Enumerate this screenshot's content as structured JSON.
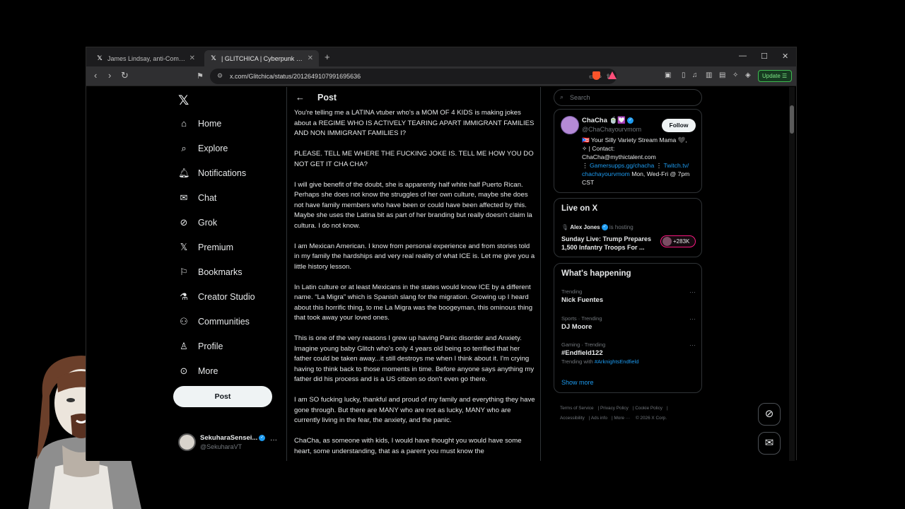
{
  "browser": {
    "tabs": [
      {
        "title": "James Lindsay, anti-Communist on X",
        "active": false
      },
      {
        "title": "| GLITCHICA | Cyberpunk Vtuber",
        "active": true
      }
    ],
    "url": "x.com/Glitchica/status/2012649107991695636",
    "update_label": "Update"
  },
  "nav": {
    "items": [
      {
        "id": "home",
        "label": "Home",
        "icon": "home-icon"
      },
      {
        "id": "explore",
        "label": "Explore",
        "icon": "search-icon"
      },
      {
        "id": "notifications",
        "label": "Notifications",
        "icon": "bell-icon"
      },
      {
        "id": "chat",
        "label": "Chat",
        "icon": "mail-icon"
      },
      {
        "id": "grok",
        "label": "Grok",
        "icon": "grok-icon"
      },
      {
        "id": "premium",
        "label": "Premium",
        "icon": "x-logo-icon"
      },
      {
        "id": "bookmarks",
        "label": "Bookmarks",
        "icon": "bookmark-icon"
      },
      {
        "id": "creator-studio",
        "label": "Creator Studio",
        "icon": "flask-icon"
      },
      {
        "id": "communities",
        "label": "Communities",
        "icon": "people-icon"
      },
      {
        "id": "profile",
        "label": "Profile",
        "icon": "person-icon"
      },
      {
        "id": "more",
        "label": "More",
        "icon": "more-circle-icon"
      }
    ],
    "post_button": "Post",
    "account": {
      "name": "SekuharaSensei...",
      "handle": "@SekuharaVT"
    }
  },
  "post": {
    "header_title": "Post",
    "paragraphs": [
      "You're telling me a LATINA vtuber who's a MOM OF 4 KIDS is making jokes about a REGIME WHO IS ACTIVELY TEARING APART IMMIGRANT FAMILIES AND NON IMMIGRANT FAMILIES I?",
      "PLEASE. TELL ME WHERE THE FUCKING JOKE IS. TELL ME HOW YOU DO NOT GET IT CHA CHA?",
      "I will give benefit of the doubt, she is apparently half white half Puerto Rican. Perhaps she does not know the struggles of her own culture, maybe she does not have family members who have been or could have been affected by this. Maybe she uses the Latina bit as part of her branding but really doesn't claim la cultura. I do not know.",
      "I am Mexican American. I know from personal experience and from stories told in my family the hardships and very real reality of what ICE is. Let me give you a little history lesson.",
      "In Latin culture or at least Mexicans in the states would know ICE by a different name. “La Migra” which is Spanish slang for the migration. Growing up I heard about this horrific thing, to me La Migra was the boogeyman, this ominous thing that took away your loved ones.",
      "This is one of the very reasons I grew up having Panic disorder and Anxiety. Imagine young baby Glitch who's only 4 years old being so terrified that her father could be taken away...it still destroys me when I think about it. I'm crying having to think back to those moments in time. Before anyone says anything my father did his process and is a US citizen so don't even go there.",
      "I am SO fucking lucky, thankful and proud of my family and everything they have gone through. But there are MANY who are not as lucky, MANY who are currently living in the fear, the anxiety, and the panic.",
      "ChaCha, as someone with kids, I would have thought you would have some heart, some understanding, that as a parent you must know the"
    ]
  },
  "sidebar": {
    "search_placeholder": "Search",
    "profile": {
      "name": "ChaCha 🍵💟",
      "handle": "@ChaChayourvmom",
      "follow_label": "Follow",
      "bio_line1": "🇵🇷 Your Silly Variety Stream Mama 🖤,",
      "bio_line2": "✧ | Contact:",
      "bio_line3": "ChaCha@mythictalent.com",
      "bio_link1": "Gamersupps.gg/chacha",
      "bio_link2": "Twitch.tv/",
      "bio_link3": "chachayourvmom",
      "bio_tail": "Mon, Wed-Fri @ 7pm CST"
    },
    "live": {
      "title": "Live on X",
      "host": "Alex Jones",
      "host_suffix": "is hosting",
      "stream_title": "Sunday Live: Trump Prepares 1,500 Infantry Troops For ...",
      "viewers": "+283K"
    },
    "happening": {
      "title": "What's happening",
      "trends": [
        {
          "context": "Trending",
          "name": "Nick Fuentes",
          "with": ""
        },
        {
          "context": "Sports · Trending",
          "name": "DJ Moore",
          "with": ""
        },
        {
          "context": "Gaming · Trending",
          "name": "#Endfield122",
          "with_prefix": "Trending with",
          "with": "#ArknightsEndfield"
        }
      ],
      "show_more": "Show more"
    },
    "footer": [
      "Terms of Service",
      "Privacy Policy",
      "Cookie Policy",
      "Accessibility",
      "Ads info",
      "More ···",
      "© 2026 X Corp."
    ]
  },
  "colors": {
    "accent": "#1d9bf0",
    "background": "#000000",
    "text": "#e7e9ea",
    "muted": "#71767b",
    "live_border": "#f91880"
  }
}
